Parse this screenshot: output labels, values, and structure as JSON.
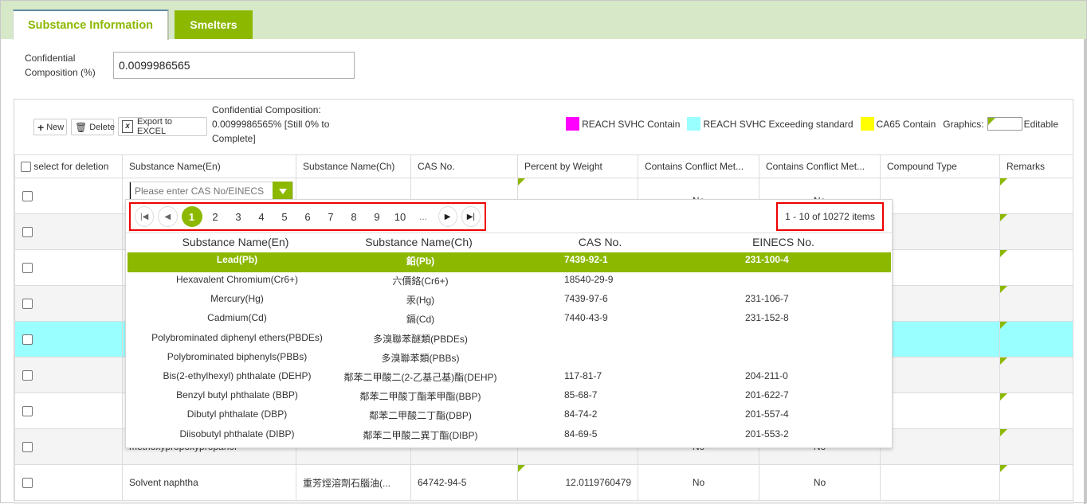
{
  "tabs": [
    {
      "label": "Substance Information",
      "active": true
    },
    {
      "label": "Smelters",
      "active": false
    }
  ],
  "confidential": {
    "label": "Confidential Composition (%)",
    "value": "0.0099986565"
  },
  "toolbar": {
    "new_label": "New",
    "delete_label": "Delete",
    "export_label": "Export to EXCEL",
    "status_text": "Confidential Composition: 0.0099986565% [Still 0% to Complete]"
  },
  "legend": {
    "items": [
      {
        "label": "REACH SVHC Contain",
        "color": "#ff00ff"
      },
      {
        "label": "REACH SVHC Exceeding standard",
        "color": "#99ffff"
      },
      {
        "label": "CA65 Contain",
        "color": "#ffff00"
      }
    ],
    "graphics_label": "Graphics:",
    "editable_label": "Editable",
    "editable_color": "#8cb800"
  },
  "grid": {
    "select_all_label": "select for deletion",
    "columns": [
      "Substance Name(En)",
      "Substance Name(Ch)",
      "CAS No.",
      "Percent by Weight",
      "Contains Conflict Met...",
      "Contains Conflict Met...",
      "Compound Type",
      "Remarks"
    ],
    "combo_placeholder": "Please enter CAS No/EINECS",
    "rows": [
      {
        "en": "",
        "ch": "",
        "cas": "",
        "pct": "",
        "cm1": "No",
        "cm2": "No",
        "type": "",
        "remarks": "",
        "style": "normal"
      },
      {
        "en": "",
        "ch": "",
        "cas": "",
        "pct": "",
        "cm1": "",
        "cm2": "",
        "type": "",
        "remarks": "",
        "style": "alt"
      },
      {
        "en": "",
        "ch": "",
        "cas": "",
        "pct": "",
        "cm1": "",
        "cm2": "",
        "type": "",
        "remarks": "",
        "style": "normal"
      },
      {
        "en": "",
        "ch": "",
        "cas": "",
        "pct": "",
        "cm1": "",
        "cm2": "",
        "type": "",
        "remarks": "",
        "style": "alt"
      },
      {
        "en": "",
        "ch": "",
        "cas": "",
        "pct": "",
        "cm1": "",
        "cm2": "",
        "type": "",
        "remarks": "",
        "style": "cyan"
      },
      {
        "en": "",
        "ch": "",
        "cas": "",
        "pct": "",
        "cm1": "",
        "cm2": "",
        "type": "",
        "remarks": "",
        "style": "alt"
      },
      {
        "en": "",
        "ch": "",
        "cas": "",
        "pct": "",
        "cm1": "",
        "cm2": "",
        "type": "",
        "remarks": "",
        "style": "normal"
      },
      {
        "en": "methoxypropoxypropanol",
        "ch": "",
        "cas": "",
        "pct": "",
        "cm1": "No",
        "cm2": "No",
        "type": "",
        "remarks": "",
        "style": "alt"
      },
      {
        "en": "Solvent naphtha",
        "ch": "重芳烴溶劑石腦油(...",
        "cas": "64742-94-5",
        "pct": "12.0119760479",
        "cm1": "No",
        "cm2": "No",
        "type": "",
        "remarks": "",
        "style": "normal"
      }
    ]
  },
  "dropdown": {
    "pager": {
      "first_icon": "first-page-icon",
      "prev_icon": "prev-page-icon",
      "pages": [
        "1",
        "2",
        "3",
        "4",
        "5",
        "6",
        "7",
        "8",
        "9",
        "10"
      ],
      "current_page": "1",
      "ellipsis": "...",
      "next_icon": "next-page-icon",
      "last_icon": "last-page-icon",
      "info": "1 - 10 of 10272 items"
    },
    "columns": [
      "Substance Name(En)",
      "Substance Name(Ch)",
      "CAS No.",
      "EINECS No."
    ],
    "rows": [
      {
        "en": "Lead(Pb)",
        "ch": "鉛(Pb)",
        "cas": "7439-92-1",
        "einecs": "231-100-4",
        "selected": true
      },
      {
        "en": "Hexavalent Chromium(Cr6+)",
        "ch": "六價鉻(Cr6+)",
        "cas": "18540-29-9",
        "einecs": ""
      },
      {
        "en": "Mercury(Hg)",
        "ch": "汞(Hg)",
        "cas": "7439-97-6",
        "einecs": "231-106-7"
      },
      {
        "en": "Cadmium(Cd)",
        "ch": "鎘(Cd)",
        "cas": "7440-43-9",
        "einecs": "231-152-8"
      },
      {
        "en": "Polybrominated diphenyl ethers(PBDEs)",
        "ch": "多溴聯苯醚類(PBDEs)",
        "cas": "",
        "einecs": ""
      },
      {
        "en": "Polybrominated biphenyls(PBBs)",
        "ch": "多溴聯苯類(PBBs)",
        "cas": "",
        "einecs": ""
      },
      {
        "en": "Bis(2-ethylhexyl) phthalate (DEHP)",
        "ch": "鄰苯二甲酸二(2-乙基己基)酯(DEHP)",
        "cas": "117-81-7",
        "einecs": "204-211-0"
      },
      {
        "en": "Benzyl butyl phthalate (BBP)",
        "ch": "鄰苯二甲酸丁酯苯甲酯(BBP)",
        "cas": "85-68-7",
        "einecs": "201-622-7"
      },
      {
        "en": "Dibutyl phthalate (DBP)",
        "ch": "鄰苯二甲酸二丁酯(DBP)",
        "cas": "84-74-2",
        "einecs": "201-557-4"
      },
      {
        "en": "Diisobutyl phthalate (DIBP)",
        "ch": "鄰苯二甲酸二異丁酯(DIBP)",
        "cas": "84-69-5",
        "einecs": "201-553-2"
      }
    ]
  }
}
